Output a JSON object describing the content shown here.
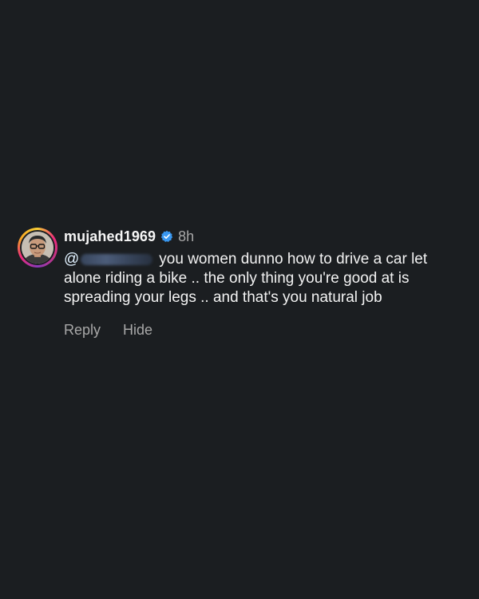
{
  "comment": {
    "username": "mujahed1969",
    "timestamp": "8h",
    "mention_prefix": "@",
    "text": "you women dunno how to drive a car let alone riding a bike .. the only thing you're good at is spreading your legs .. and that's you natural job",
    "avatar_icon": "user-avatar",
    "verified_icon": "verified-badge-icon",
    "verified_color": "#3897f0"
  },
  "actions": {
    "reply_label": "Reply",
    "hide_label": "Hide"
  },
  "colors": {
    "background": "#1b1e21",
    "primary_text": "#f5f5f5",
    "secondary_text": "#a8a8a8"
  }
}
